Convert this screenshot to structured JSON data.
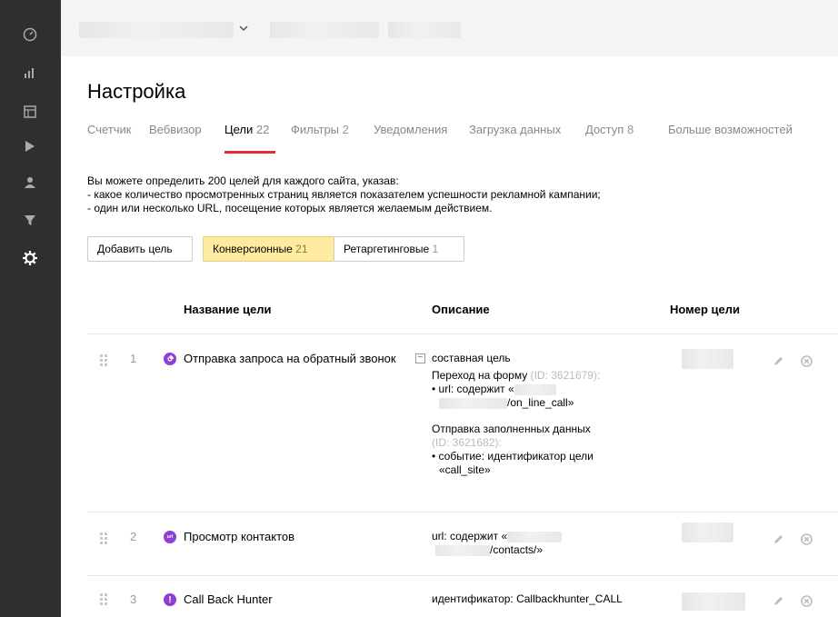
{
  "sidebar": {
    "icons": [
      "dashboard-icon",
      "reports-icon",
      "maps-icon",
      "webvisor-icon",
      "audience-icon",
      "segments-icon",
      "settings-icon"
    ]
  },
  "page": {
    "title": "Настройка"
  },
  "tabs": [
    {
      "label": "Счетчик",
      "count": ""
    },
    {
      "label": "Вебвизор",
      "count": ""
    },
    {
      "label": "Цели",
      "count": "22"
    },
    {
      "label": "Фильтры",
      "count": "2"
    },
    {
      "label": "Уведомления",
      "count": ""
    },
    {
      "label": "Загрузка данных",
      "count": ""
    },
    {
      "label": "Доступ",
      "count": "8"
    },
    {
      "label": "Больше возможностей",
      "count": ""
    }
  ],
  "info": {
    "line1": "Вы можете определить 200 целей для каждого сайта, указав:",
    "line2": "- какое количество просмотренных страниц является показателем успешности рекламной кампании;",
    "line3": "- один или несколько URL, посещение которых является желаемым действием."
  },
  "buttons": {
    "add": "Добавить цель",
    "conversion": "Конверсионные",
    "conversion_count": "21",
    "retargeting": "Ретаргетинговые",
    "retargeting_count": "1"
  },
  "table": {
    "headers": {
      "name": "Название цели",
      "description": "Описание",
      "number": "Номер цели"
    },
    "rows": [
      {
        "num": "1",
        "name": "Отправка запроса на обратный звонок",
        "type": "составная цель",
        "step1_title": "Переход на форму",
        "step1_id": "(ID: 3621679):",
        "step1_cond": "• url: содержит «",
        "step1_tail": "/on_line_call»",
        "step2_title": "Отправка заполненных данных",
        "step2_id": "(ID: 3621682):",
        "step2_cond": "• событие: идентификатор цели",
        "step2_tail": "«call_site»"
      },
      {
        "num": "2",
        "name": "Просмотр контактов",
        "cond": "url: содержит «",
        "tail": "/contacts/»"
      },
      {
        "num": "3",
        "name": "Call Back Hunter",
        "cond": "идентификатор: Callbackhunter_CALL"
      }
    ]
  },
  "colors": {
    "accent": "#e62e2e",
    "goal_purple": "#8e3fd6",
    "selected_bg": "#ffeba0",
    "sidebar_bg": "#2f2f2f"
  }
}
